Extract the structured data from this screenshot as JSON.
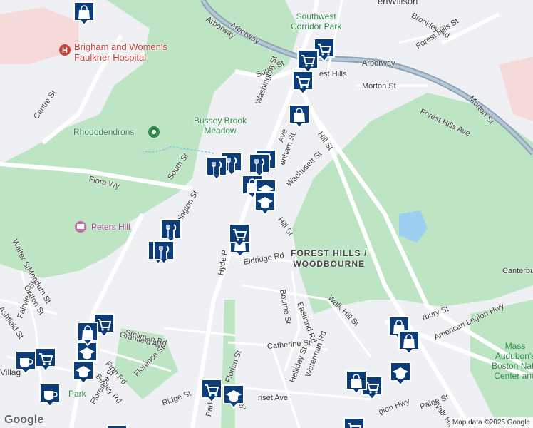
{
  "map": {
    "colors": {
      "background": "#eef0f3",
      "park": "#bde5c4",
      "park_dark": "#a7d9b1",
      "road": "#ffffff",
      "highway": "#8da3b8",
      "hospital": "#f6dad9",
      "pin": "#0b3d7a",
      "pin_border": "#ffffff"
    },
    "street_labels": [
      {
        "id": "arborway-nw",
        "text": "Arborway"
      },
      {
        "id": "arborway-ne",
        "text": "Arborway"
      },
      {
        "id": "arborway-w",
        "text": "Arborway"
      },
      {
        "id": "brookley",
        "text": "Brookley Rd"
      },
      {
        "id": "forest-hills-st",
        "text": "Forest Hills St"
      },
      {
        "id": "south-st-n",
        "text": "South St"
      },
      {
        "id": "forest-hills-partial",
        "text": "est Hills"
      },
      {
        "id": "morton",
        "text": "Morton St"
      },
      {
        "id": "morton-e",
        "text": "Morton St"
      },
      {
        "id": "washington-n",
        "text": "Washington St"
      },
      {
        "id": "forest-hills-ave",
        "text": "Forest Hills Ave"
      },
      {
        "id": "hill-st",
        "text": "Hill St"
      },
      {
        "id": "centre",
        "text": "Centre St"
      },
      {
        "id": "flora",
        "text": "Flora Wy"
      },
      {
        "id": "south-st-s",
        "text": "South St"
      },
      {
        "id": "ave",
        "text": "Ave"
      },
      {
        "id": "tenham",
        "text": "enham St"
      },
      {
        "id": "wachusett",
        "text": "Wachusett St"
      },
      {
        "id": "washington-s",
        "text": "shington St"
      },
      {
        "id": "walter",
        "text": "Walter St"
      },
      {
        "id": "hill-st-2",
        "text": "Hill St"
      },
      {
        "id": "mendum",
        "text": "Mendum St"
      },
      {
        "id": "cotton",
        "text": "Cotton St"
      },
      {
        "id": "ashfield",
        "text": "Ashfield St"
      },
      {
        "id": "fairview",
        "text": "Fairview St"
      },
      {
        "id": "eldridge",
        "text": "Eldridge Rd"
      },
      {
        "id": "hyde",
        "text": "Hyde P"
      },
      {
        "id": "bourne",
        "text": "Bourne St"
      },
      {
        "id": "eastland",
        "text": "Eastland Rd"
      },
      {
        "id": "walk-hill",
        "text": "Walk Hill St"
      },
      {
        "id": "canterbury",
        "text": "rbury St"
      },
      {
        "id": "american-legion",
        "text": "American Legion Hwy"
      },
      {
        "id": "granfield",
        "text": "Granfield Ave"
      },
      {
        "id": "stellman",
        "text": "Stellman Rd"
      },
      {
        "id": "firth",
        "text": "Firth Rd"
      },
      {
        "id": "bexley",
        "text": "Bexley Rd"
      },
      {
        "id": "florence-1",
        "text": "Florence St"
      },
      {
        "id": "florence-2",
        "text": "Florence St"
      },
      {
        "id": "catherine",
        "text": "Catherine St"
      },
      {
        "id": "halliday",
        "text": "Halliday St"
      },
      {
        "id": "waterman",
        "text": "Waterman Rd"
      },
      {
        "id": "florian",
        "text": "Florian St"
      },
      {
        "id": "sunset",
        "text": "nset Ave"
      },
      {
        "id": "ridge",
        "text": "Ridge St"
      },
      {
        "id": "park",
        "text": "Park"
      },
      {
        "id": "well",
        "text": "well"
      },
      {
        "id": "walk-hill-2",
        "text": "Walk Hill St"
      },
      {
        "id": "paine",
        "text": "Paine St"
      },
      {
        "id": "gion",
        "text": "gion Hwy"
      }
    ],
    "place_labels": {
      "southwest_corridor_line1": "Southwest",
      "southwest_corridor_line2": "Corridor Park",
      "hospital_line1": "Brigham and Women's",
      "hospital_line2": "Faulkner Hospital",
      "bussey_line1": "Bussey Brook",
      "bussey_line2": "Meadow",
      "rhododendrons": "Rhododendrons",
      "peters_hill": "Peters Hill",
      "neighborhood_line1": "FOREST HILLS /",
      "neighborhood_line2": "WOODBOURNE",
      "canterbu": "Canterbu",
      "mass_audubon_line1": "Mass",
      "mass_audubon_line2": "Audubon's",
      "mass_audubon_line3": "Boston Natu",
      "mass_audubon_line4": "Center and",
      "top_partial": "enWillson",
      "villag": "Villag",
      "a_park": "A",
      "a_park2": "Park"
    },
    "attribution": "Map data ©2025 Google",
    "logo": "Google",
    "pins": [
      {
        "id": "shop-1",
        "icon": "cart-icon"
      },
      {
        "id": "shop-2",
        "icon": "cart-icon"
      },
      {
        "id": "shop-3",
        "icon": "bag-icon"
      },
      {
        "id": "shop-4",
        "icon": "cart-icon"
      },
      {
        "id": "food-1",
        "icon": "utensils-icon"
      },
      {
        "id": "food-2",
        "icon": "utensils-icon"
      },
      {
        "id": "food-3",
        "icon": "utensils-icon"
      },
      {
        "id": "food-4",
        "icon": "utensils-icon"
      },
      {
        "id": "bag-2",
        "icon": "bag-icon"
      },
      {
        "id": "school-1",
        "icon": "school-icon"
      },
      {
        "id": "school-2",
        "icon": "school-icon"
      },
      {
        "id": "food-5",
        "icon": "utensils-icon"
      },
      {
        "id": "food-6",
        "icon": "utensils-icon"
      },
      {
        "id": "food-7",
        "icon": "utensils-icon"
      },
      {
        "id": "bag-3",
        "icon": "bag-icon"
      },
      {
        "id": "cart-5",
        "icon": "cart-icon"
      },
      {
        "id": "bag-4",
        "icon": "bag-icon"
      },
      {
        "id": "school-3",
        "icon": "school-icon"
      },
      {
        "id": "school-4",
        "icon": "school-icon"
      },
      {
        "id": "cart-6",
        "icon": "cart-icon"
      },
      {
        "id": "coffee-1",
        "icon": "coffee-icon"
      },
      {
        "id": "coffee-2",
        "icon": "coffee-icon"
      },
      {
        "id": "bag-5",
        "icon": "bag-icon"
      },
      {
        "id": "bag-6",
        "icon": "bag-icon"
      },
      {
        "id": "school-5",
        "icon": "school-icon"
      },
      {
        "id": "cart-7",
        "icon": "cart-icon"
      },
      {
        "id": "bag-7",
        "icon": "bag-icon"
      },
      {
        "id": "cart-8",
        "icon": "cart-icon"
      },
      {
        "id": "school-6",
        "icon": "school-icon"
      },
      {
        "id": "cart-9",
        "icon": "cart-icon"
      },
      {
        "id": "bag-top",
        "icon": "bag-icon"
      },
      {
        "id": "cart-10",
        "icon": "cart-icon"
      },
      {
        "id": "cart-11",
        "icon": "cart-icon"
      }
    ]
  }
}
